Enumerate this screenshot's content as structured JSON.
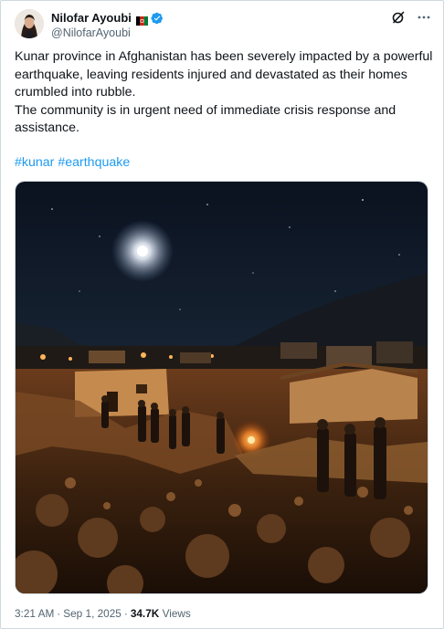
{
  "author": {
    "display_name": "Nilofar Ayoubi",
    "handle": "@NilofarAyoubi"
  },
  "tweet": {
    "paragraph1": "Kunar province in Afghanistan has been severely impacted by a powerful earthquake, leaving residents injured and devastated as their homes crumbled into rubble.",
    "paragraph2": "The community is in urgent need of immediate crisis response and assistance.",
    "hashtags": [
      "#kunar",
      "#earthquake"
    ]
  },
  "meta": {
    "time": "3:21 AM",
    "date": "Sep 1, 2025",
    "views_count": "34.7K",
    "views_label": "Views"
  },
  "icons": {
    "grok": "grok-icon",
    "more": "more-icon",
    "verified": "verified-badge-icon",
    "flag": "afghanistan-flag-icon"
  },
  "colors": {
    "link": "#1d9bf0",
    "verified": "#1d9bf0",
    "secondary_text": "#536471",
    "border": "#cfd9de"
  }
}
